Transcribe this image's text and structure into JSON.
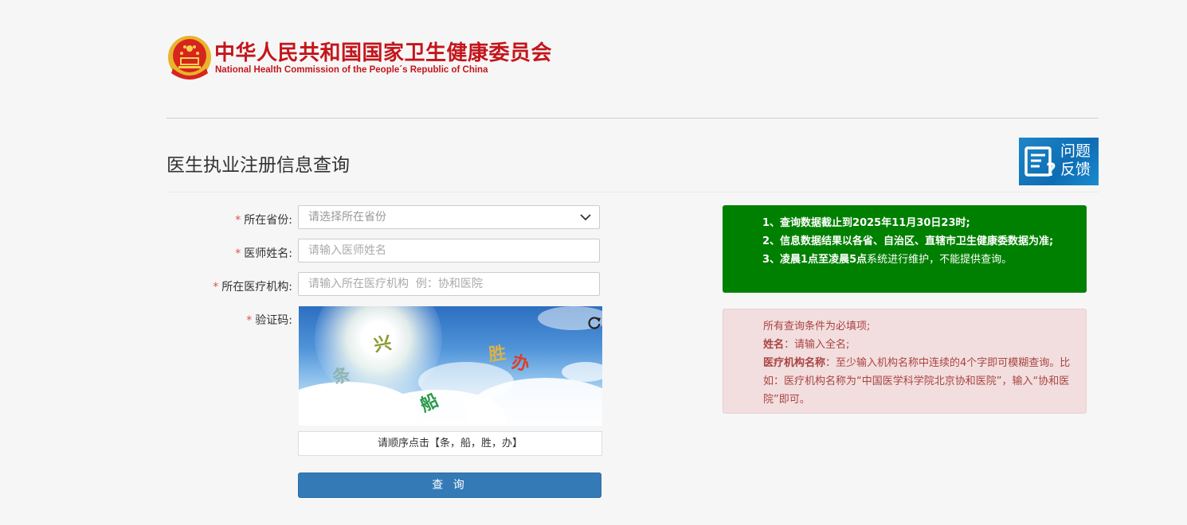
{
  "header": {
    "org_cn": "中华人民共和国国家卫生健康委员会",
    "org_en": "National Health Commission of the People´s Republic of China"
  },
  "page": {
    "title": "医生执业注册信息查询"
  },
  "feedback": {
    "line1": "问题",
    "line2": "反馈"
  },
  "form": {
    "required_mark": "*",
    "province": {
      "label": "所在省份:",
      "placeholder": "请选择所在省份"
    },
    "name": {
      "label": "医师姓名:",
      "placeholder": "请输入医师姓名"
    },
    "institution": {
      "label": "所在医疗机构:",
      "placeholder": "请输入所在医疗机构  例：协和医院"
    },
    "captcha": {
      "label": "验证码:",
      "chars": [
        "兴",
        "胜",
        "办",
        "条",
        "船"
      ],
      "hint": "请顺序点击【条，船，胜，办】"
    },
    "submit_label": "查 询"
  },
  "notice_green": {
    "line1": "1、查询数据截止到2025年11月30日23时;",
    "line2": "2、信息数据结果以各省、自治区、直辖市卫生健康委数据为准;",
    "line3_bold": "3、凌晨1点至凌晨5点",
    "line3_rest": "系统进行维护，不能提供查询。"
  },
  "notice_red": {
    "line1": "所有查询条件为必填项;",
    "name_label": "姓名",
    "name_text": "：请输入全名;",
    "inst_label": "医疗机构名称",
    "inst_text": "：至少输入机构名称中连续的4个字即可模糊查询。比如：医疗机构名称为“中国医学科学院北京协和医院”，输入“协和医院”即可。"
  },
  "colors": {
    "brand_red": "#c3161c",
    "primary_blue": "#337ab7",
    "notice_green": "#008000",
    "notice_red_bg": "#f2dede",
    "notice_red_text": "#a94442"
  },
  "icons": {
    "emblem": "national-emblem-icon",
    "feedback": "feedback-icon",
    "refresh": "refresh-icon",
    "select": "chevron-down-icon"
  }
}
